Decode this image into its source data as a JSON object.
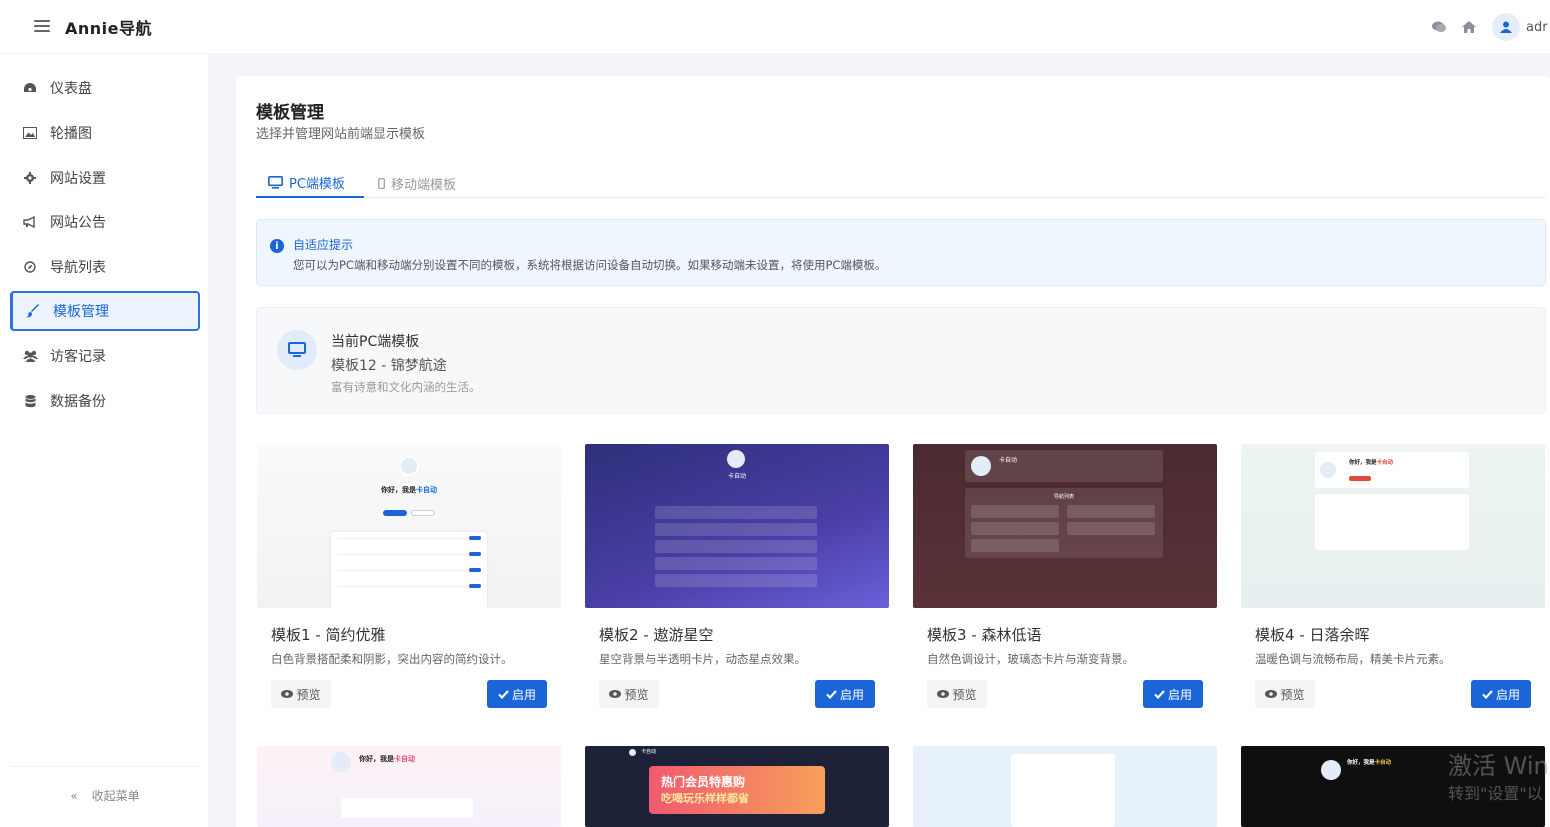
{
  "header": {
    "brand": "Annie导航",
    "user": "adr"
  },
  "sidebar": {
    "items": [
      {
        "label": "仪表盘",
        "icon": "dashboard-icon"
      },
      {
        "label": "轮播图",
        "icon": "image-icon"
      },
      {
        "label": "网站设置",
        "icon": "gear-icon"
      },
      {
        "label": "网站公告",
        "icon": "megaphone-icon"
      },
      {
        "label": "导航列表",
        "icon": "compass-icon"
      },
      {
        "label": "模板管理",
        "icon": "brush-icon"
      },
      {
        "label": "访客记录",
        "icon": "users-icon"
      },
      {
        "label": "数据备份",
        "icon": "database-icon"
      }
    ],
    "active_index": 5,
    "collapse": "收起菜单"
  },
  "page": {
    "title": "模板管理",
    "subtitle": "选择并管理网站前端显示模板"
  },
  "tabs": [
    {
      "label": "PC端模板",
      "active": true
    },
    {
      "label": "移动端模板",
      "active": false
    }
  ],
  "notice": {
    "title": "自适应提示",
    "text": "您可以为PC端和移动端分别设置不同的模板，系统将根据访问设备自动切换。如果移动端未设置，将使用PC端模板。"
  },
  "current": {
    "label": "当前PC端模板",
    "name": "模板12 - 锦梦航途",
    "desc": "富有诗意和文化内涵的生活。"
  },
  "cards": [
    {
      "title": "模板1 - 简约优雅",
      "desc": "白色背景搭配柔和阴影，突出内容的简约设计。",
      "preview": "预览",
      "enable": "启用",
      "thumb_greeting": "你好，我是",
      "thumb_brand": "卡自动"
    },
    {
      "title": "模板2 - 遨游星空",
      "desc": "星空背景与半透明卡片，动态星点效果。",
      "preview": "预览",
      "enable": "启用",
      "thumb_brand": "卡自动"
    },
    {
      "title": "模板3 - 森林低语",
      "desc": "自然色调设计，玻璃态卡片与渐变背景。",
      "preview": "预览",
      "enable": "启用",
      "thumb_brand": "卡自动",
      "thumb_section": "导航列表"
    },
    {
      "title": "模板4 - 日落余晖",
      "desc": "温暖色调与流畅布局，精美卡片元素。",
      "preview": "预览",
      "enable": "启用",
      "thumb_greeting": "你好，我是",
      "thumb_brand": "卡自动"
    }
  ],
  "cards_row2": [
    {
      "thumb_greeting": "你好，我是",
      "thumb_brand": "卡自动"
    },
    {
      "thumb_brand": "卡自动",
      "thumb_banner": "热门会员特惠购",
      "thumb_banner_sub": "吃喝玩乐样样都省"
    },
    {},
    {
      "thumb_greeting": "你好，我是",
      "thumb_brand": "卡自动"
    }
  ],
  "watermark": {
    "line1": "激活 Win",
    "line2": "转到\"设置\"以"
  },
  "colors": {
    "accent": "#1a66d9"
  }
}
